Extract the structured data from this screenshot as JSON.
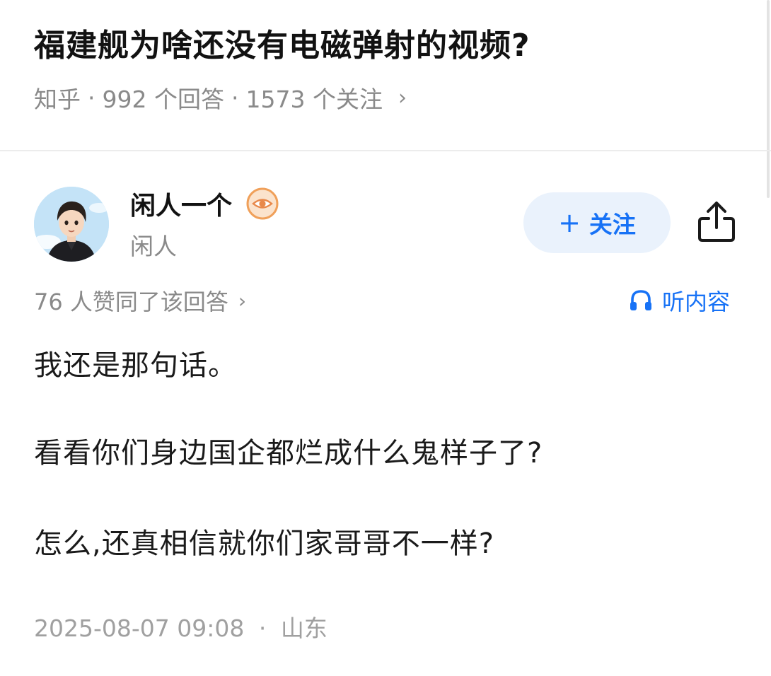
{
  "question": {
    "title": "福建舰为啥还没有电磁弹射的视频?",
    "source": "知乎",
    "separator": "·",
    "answers": "992 个回答",
    "followers": "1573 个关注",
    "chevron": "›"
  },
  "author": {
    "name": "闲人一个",
    "bio": "闲人",
    "badge_icon": "eye-badge-icon",
    "badge_color": "#f0a05a"
  },
  "actions": {
    "follow_plus": "+",
    "follow_label": "关注",
    "share_icon": "share-icon"
  },
  "answer": {
    "upvotes": "76 人赞同了该回答",
    "upvotes_chevron": "›",
    "listen_label": "听内容",
    "paragraphs": [
      "我还是那句话。",
      "看看你们身边国企都烂成什么鬼样子了?",
      "怎么,还真相信就你们家哥哥不一样?"
    ],
    "timestamp": "2025-08-07 09:08",
    "timestamp_separator": "·",
    "location": "山东"
  },
  "colors": {
    "accent": "#1772f6",
    "follow_bg": "#eaf2fc",
    "muted_text": "#8a8a8a"
  }
}
